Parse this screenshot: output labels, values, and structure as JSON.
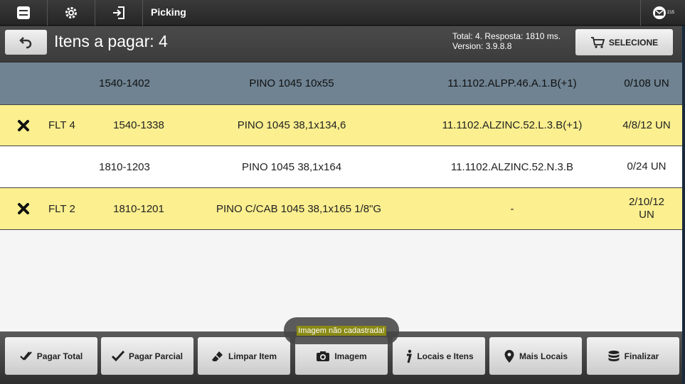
{
  "topbar": {
    "title": "Picking",
    "mail_count": "215"
  },
  "header": {
    "title": "Itens a pagar: 4",
    "info_line1": "Total: 4. Resposta: 1810 ms.",
    "info_line2": "Version: 3.9.8.8",
    "select_label": "SELECIONE"
  },
  "rows": [
    {
      "style": "selected",
      "mark": "",
      "flt": "",
      "code": "1540-1402",
      "desc": "PINO 1045 10x55",
      "loc": "11.1102.ALPP.46.A.1.B(+1)",
      "qty": "0/108 UN"
    },
    {
      "style": "yellow",
      "mark": "x",
      "flt": "FLT 4",
      "code": "1540-1338",
      "desc": "PINO 1045 38,1x134,6",
      "loc": "11.1102.ALZINC.52.L.3.B(+1)",
      "qty": "4/8/12 UN"
    },
    {
      "style": "white",
      "mark": "",
      "flt": "",
      "code": "1810-1203",
      "desc": "PINO 1045 38,1x164",
      "loc": "11.1102.ALZINC.52.N.3.B",
      "qty": "0/24 UN"
    },
    {
      "style": "yellow",
      "mark": "x",
      "flt": "FLT 2",
      "code": "1810-1201",
      "desc": "PINO C/CAB 1045 38,1x165 1/8\"G",
      "loc": "-",
      "qty_line1": "2/10/12",
      "qty_line2": "UN"
    }
  ],
  "toast": "Imagem não cadastrada!",
  "bottom": {
    "pagar_total": "Pagar Total",
    "pagar_parcial": "Pagar Parcial",
    "limpar_item": "Limpar Item",
    "imagem": "Imagem",
    "locais_itens": "Locais e Itens",
    "mais_locais": "Mais Locais",
    "finalizar": "Finalizar"
  },
  "colors": {
    "selected_row": "#6f8392",
    "highlight_row": "#fbef8f"
  }
}
